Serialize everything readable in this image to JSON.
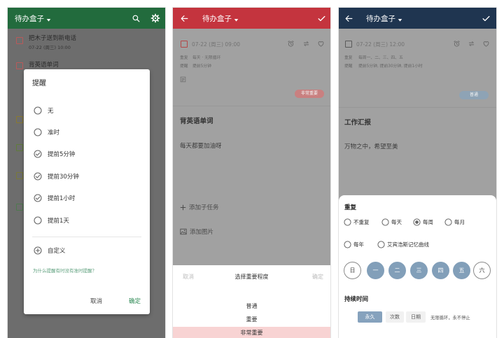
{
  "reminder_screen": {
    "colors": {
      "header": "#226b3d",
      "confirm": "#2e8a55",
      "help_link": "#5c9f7c"
    },
    "header": {
      "title": "待办盒子"
    },
    "list": [
      {
        "title": "把木子送到新电话",
        "meta": "07-22 (周三) 10:00"
      },
      {
        "title": "背英语单词"
      }
    ],
    "dialog": {
      "title": "提醒",
      "options": [
        {
          "label": "无",
          "checked": false
        },
        {
          "label": "准时",
          "checked": false
        },
        {
          "label": "提前5分钟",
          "checked": true
        },
        {
          "label": "提前30分钟",
          "checked": true
        },
        {
          "label": "提前1小时",
          "checked": true
        },
        {
          "label": "提前1天",
          "checked": false
        }
      ],
      "custom_label": "自定义",
      "help_link": "为什么提醒有时没有准时提醒？",
      "cancel": "取消",
      "confirm": "确定"
    }
  },
  "importance_screen": {
    "colors": {
      "header": "#c4343e",
      "badge": "#c98080",
      "selected_row": "#f8d3d3"
    },
    "header": {
      "title": "待办盒子"
    },
    "task": {
      "date": "07-22 (周三) 09:00",
      "repeat_label": "重复",
      "repeat_value": "每天 · 无限循环",
      "remind_label": "提醒",
      "remind_value": "提前5分钟",
      "priority_badge": "非常重要",
      "title": "背英语单词",
      "note": "每天都要加油呀",
      "add_subtask": "添加子任务",
      "add_image": "添加图片"
    },
    "sheet": {
      "cancel": "取消",
      "title": "选择重要程度",
      "confirm": "确定",
      "options": [
        {
          "label": "普通",
          "selected": false
        },
        {
          "label": "重要",
          "selected": false
        },
        {
          "label": "非常重要",
          "selected": true
        }
      ]
    }
  },
  "repeat_screen": {
    "colors": {
      "header": "#1f3550",
      "badge": "#8ea3b5",
      "selected": "#829fb9"
    },
    "header": {
      "title": "待办盒子"
    },
    "task": {
      "date": "07-22 (周三) 12:00",
      "repeat_label": "重复",
      "repeat_value": "每周一、二、三、四、五",
      "remind_label": "提醒",
      "remind_value": "提前5分钟, 提前30分钟, 提前1小时",
      "priority_badge": "普通",
      "title": "工作汇报",
      "note": "万物之中，希望至美"
    },
    "sheet": {
      "repeat_title": "重复",
      "repeat_options": [
        {
          "label": "不重复",
          "selected": false
        },
        {
          "label": "每天",
          "selected": false
        },
        {
          "label": "每周",
          "selected": true
        },
        {
          "label": "每月",
          "selected": false
        },
        {
          "label": "每年",
          "selected": false
        },
        {
          "label": "艾宾浩斯记忆曲线",
          "selected": false
        }
      ],
      "days": [
        {
          "label": "日",
          "selected": false
        },
        {
          "label": "一",
          "selected": true
        },
        {
          "label": "二",
          "selected": true
        },
        {
          "label": "三",
          "selected": true
        },
        {
          "label": "四",
          "selected": true
        },
        {
          "label": "五",
          "selected": true
        },
        {
          "label": "六",
          "selected": false
        }
      ],
      "duration_title": "持续时间",
      "duration_options": [
        {
          "label": "永久",
          "selected": true
        },
        {
          "label": "次数",
          "selected": false
        },
        {
          "label": "日期",
          "selected": false
        }
      ],
      "duration_desc": "无限循环，永不停止"
    }
  }
}
